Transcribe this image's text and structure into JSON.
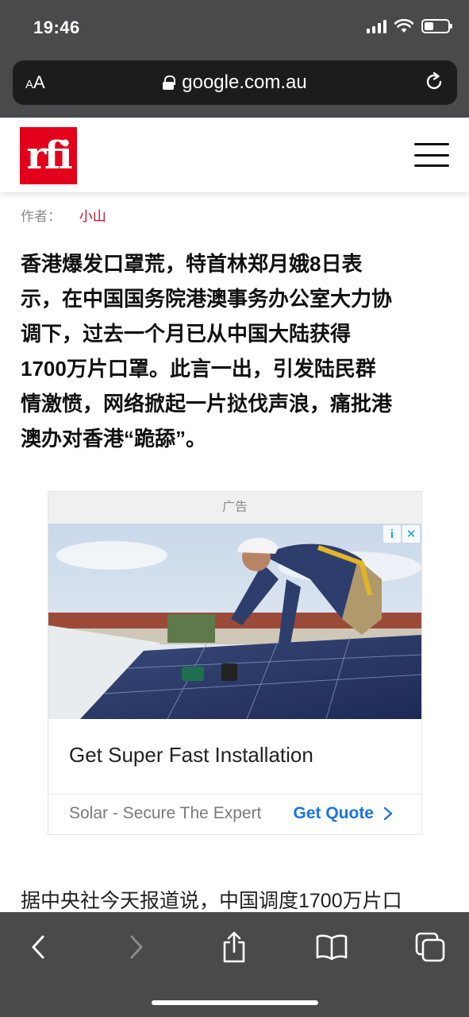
{
  "status_bar": {
    "time": "19:46"
  },
  "address_bar": {
    "text_size_label": "AA",
    "url": "google.com.au"
  },
  "site": {
    "logo_text": "rfi"
  },
  "article": {
    "byline_label": "作者：",
    "author": "小山",
    "lead_lines": [
      "香港爆发口罩荒，特首林郑月娥8日表",
      "示，在中国国务院港澳事务办公室大力协",
      "调下，过去一个月已从中国大陆获得",
      "1700万片口罩。此言一出，引发陆民群",
      "情激愤，网络掀起一片挞伐声浪，痛批港",
      "澳办对香港“跪舔”。"
    ],
    "body_start": "据中央社今天报道说，中国调度1700万片口"
  },
  "ad": {
    "label": "广告",
    "info_icon": "i",
    "close_icon": "✕",
    "title": "Get Super Fast Installation",
    "source": "Solar - Secure The Expert",
    "cta": "Get Quote",
    "cta_color": "#1a73e8"
  },
  "toolbar": {
    "icons": [
      "back-icon",
      "forward-icon",
      "share-icon",
      "bookmarks-icon",
      "tabs-icon"
    ]
  },
  "colors": {
    "chrome": "#4a4a4c",
    "brand": "#e2001a",
    "author": "#c8102e"
  }
}
